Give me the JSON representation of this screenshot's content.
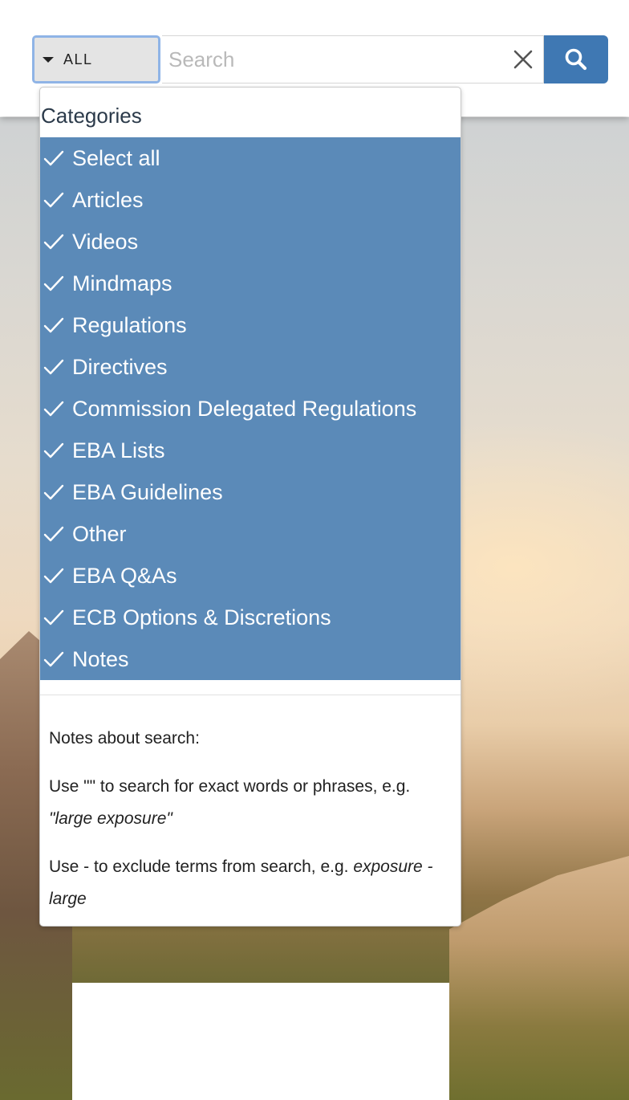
{
  "search": {
    "category_label": "ALL",
    "placeholder": "Search",
    "value": ""
  },
  "dropdown": {
    "heading": "Categories",
    "options": [
      {
        "label": "Select all",
        "checked": true
      },
      {
        "label": "Articles",
        "checked": true
      },
      {
        "label": "Videos",
        "checked": true
      },
      {
        "label": "Mindmaps",
        "checked": true
      },
      {
        "label": "Regulations",
        "checked": true
      },
      {
        "label": "Directives",
        "checked": true
      },
      {
        "label": "Commission Delegated Regulations",
        "checked": true
      },
      {
        "label": "EBA Lists",
        "checked": true
      },
      {
        "label": "EBA Guidelines",
        "checked": true
      },
      {
        "label": "Other",
        "checked": true
      },
      {
        "label": "EBA Q&As",
        "checked": true
      },
      {
        "label": "ECB Options & Discretions",
        "checked": true
      },
      {
        "label": "Notes",
        "checked": true
      }
    ],
    "notes": {
      "title": "Notes about search:",
      "line1_text": "Use \"\" to search for exact words or phrases, e.g.",
      "line1_example": "\"large exposure\"",
      "line2_text": "Use - to exclude terms from search, e.g.",
      "line2_example": "exposure -large"
    }
  },
  "icons": {
    "caret": "caret-down-icon",
    "clear": "close-icon",
    "search": "search-icon",
    "check": "check-icon"
  },
  "colors": {
    "accent": "#3f78b3",
    "selected_bg": "#5b8ab8",
    "focus_border": "#8fb4e6"
  }
}
